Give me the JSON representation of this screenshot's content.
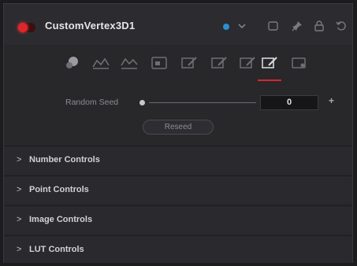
{
  "header": {
    "title": "CustomVertex3D1",
    "toggle_color": "#e0262b",
    "color_chip": "#2b8fd0",
    "icons": [
      "chevron-down-icon",
      "version-icon",
      "pin-icon",
      "lock-icon",
      "reset-icon"
    ]
  },
  "tabs": {
    "items": [
      "controls",
      "vertex",
      "pixel",
      "image",
      "settings-1",
      "settings-2",
      "settings-3",
      "settings-4"
    ],
    "active_index": 6,
    "active_color": "#d9262b"
  },
  "random_seed": {
    "label": "Random Seed",
    "value": "0",
    "plus_label": "+",
    "reseed_label": "Reseed"
  },
  "sections": [
    {
      "label": "Number Controls",
      "arrow": ">"
    },
    {
      "label": "Point Controls",
      "arrow": ">"
    },
    {
      "label": "Image Controls",
      "arrow": ">"
    },
    {
      "label": "LUT Controls",
      "arrow": ">"
    }
  ]
}
